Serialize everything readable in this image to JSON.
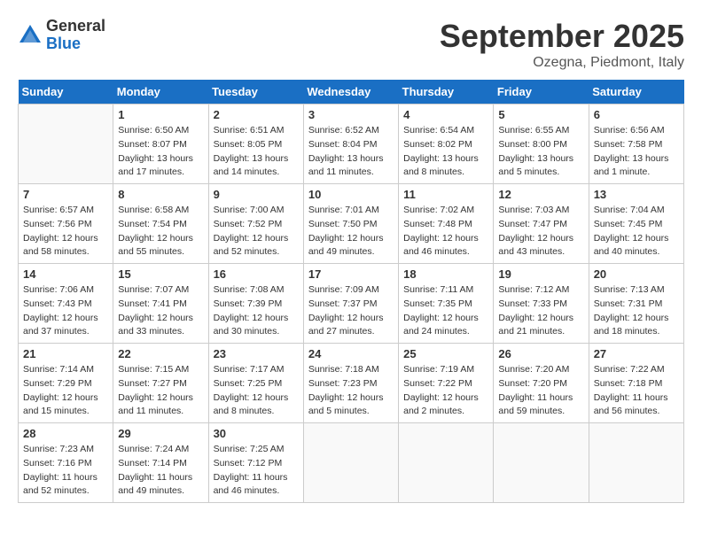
{
  "header": {
    "logo_general": "General",
    "logo_blue": "Blue",
    "month_title": "September 2025",
    "location": "Ozegna, Piedmont, Italy"
  },
  "days_of_week": [
    "Sunday",
    "Monday",
    "Tuesday",
    "Wednesday",
    "Thursday",
    "Friday",
    "Saturday"
  ],
  "weeks": [
    [
      {
        "day": "",
        "sunrise": "",
        "sunset": "",
        "daylight": ""
      },
      {
        "day": "1",
        "sunrise": "Sunrise: 6:50 AM",
        "sunset": "Sunset: 8:07 PM",
        "daylight": "Daylight: 13 hours and 17 minutes."
      },
      {
        "day": "2",
        "sunrise": "Sunrise: 6:51 AM",
        "sunset": "Sunset: 8:05 PM",
        "daylight": "Daylight: 13 hours and 14 minutes."
      },
      {
        "day": "3",
        "sunrise": "Sunrise: 6:52 AM",
        "sunset": "Sunset: 8:04 PM",
        "daylight": "Daylight: 13 hours and 11 minutes."
      },
      {
        "day": "4",
        "sunrise": "Sunrise: 6:54 AM",
        "sunset": "Sunset: 8:02 PM",
        "daylight": "Daylight: 13 hours and 8 minutes."
      },
      {
        "day": "5",
        "sunrise": "Sunrise: 6:55 AM",
        "sunset": "Sunset: 8:00 PM",
        "daylight": "Daylight: 13 hours and 5 minutes."
      },
      {
        "day": "6",
        "sunrise": "Sunrise: 6:56 AM",
        "sunset": "Sunset: 7:58 PM",
        "daylight": "Daylight: 13 hours and 1 minute."
      }
    ],
    [
      {
        "day": "7",
        "sunrise": "Sunrise: 6:57 AM",
        "sunset": "Sunset: 7:56 PM",
        "daylight": "Daylight: 12 hours and 58 minutes."
      },
      {
        "day": "8",
        "sunrise": "Sunrise: 6:58 AM",
        "sunset": "Sunset: 7:54 PM",
        "daylight": "Daylight: 12 hours and 55 minutes."
      },
      {
        "day": "9",
        "sunrise": "Sunrise: 7:00 AM",
        "sunset": "Sunset: 7:52 PM",
        "daylight": "Daylight: 12 hours and 52 minutes."
      },
      {
        "day": "10",
        "sunrise": "Sunrise: 7:01 AM",
        "sunset": "Sunset: 7:50 PM",
        "daylight": "Daylight: 12 hours and 49 minutes."
      },
      {
        "day": "11",
        "sunrise": "Sunrise: 7:02 AM",
        "sunset": "Sunset: 7:48 PM",
        "daylight": "Daylight: 12 hours and 46 minutes."
      },
      {
        "day": "12",
        "sunrise": "Sunrise: 7:03 AM",
        "sunset": "Sunset: 7:47 PM",
        "daylight": "Daylight: 12 hours and 43 minutes."
      },
      {
        "day": "13",
        "sunrise": "Sunrise: 7:04 AM",
        "sunset": "Sunset: 7:45 PM",
        "daylight": "Daylight: 12 hours and 40 minutes."
      }
    ],
    [
      {
        "day": "14",
        "sunrise": "Sunrise: 7:06 AM",
        "sunset": "Sunset: 7:43 PM",
        "daylight": "Daylight: 12 hours and 37 minutes."
      },
      {
        "day": "15",
        "sunrise": "Sunrise: 7:07 AM",
        "sunset": "Sunset: 7:41 PM",
        "daylight": "Daylight: 12 hours and 33 minutes."
      },
      {
        "day": "16",
        "sunrise": "Sunrise: 7:08 AM",
        "sunset": "Sunset: 7:39 PM",
        "daylight": "Daylight: 12 hours and 30 minutes."
      },
      {
        "day": "17",
        "sunrise": "Sunrise: 7:09 AM",
        "sunset": "Sunset: 7:37 PM",
        "daylight": "Daylight: 12 hours and 27 minutes."
      },
      {
        "day": "18",
        "sunrise": "Sunrise: 7:11 AM",
        "sunset": "Sunset: 7:35 PM",
        "daylight": "Daylight: 12 hours and 24 minutes."
      },
      {
        "day": "19",
        "sunrise": "Sunrise: 7:12 AM",
        "sunset": "Sunset: 7:33 PM",
        "daylight": "Daylight: 12 hours and 21 minutes."
      },
      {
        "day": "20",
        "sunrise": "Sunrise: 7:13 AM",
        "sunset": "Sunset: 7:31 PM",
        "daylight": "Daylight: 12 hours and 18 minutes."
      }
    ],
    [
      {
        "day": "21",
        "sunrise": "Sunrise: 7:14 AM",
        "sunset": "Sunset: 7:29 PM",
        "daylight": "Daylight: 12 hours and 15 minutes."
      },
      {
        "day": "22",
        "sunrise": "Sunrise: 7:15 AM",
        "sunset": "Sunset: 7:27 PM",
        "daylight": "Daylight: 12 hours and 11 minutes."
      },
      {
        "day": "23",
        "sunrise": "Sunrise: 7:17 AM",
        "sunset": "Sunset: 7:25 PM",
        "daylight": "Daylight: 12 hours and 8 minutes."
      },
      {
        "day": "24",
        "sunrise": "Sunrise: 7:18 AM",
        "sunset": "Sunset: 7:23 PM",
        "daylight": "Daylight: 12 hours and 5 minutes."
      },
      {
        "day": "25",
        "sunrise": "Sunrise: 7:19 AM",
        "sunset": "Sunset: 7:22 PM",
        "daylight": "Daylight: 12 hours and 2 minutes."
      },
      {
        "day": "26",
        "sunrise": "Sunrise: 7:20 AM",
        "sunset": "Sunset: 7:20 PM",
        "daylight": "Daylight: 11 hours and 59 minutes."
      },
      {
        "day": "27",
        "sunrise": "Sunrise: 7:22 AM",
        "sunset": "Sunset: 7:18 PM",
        "daylight": "Daylight: 11 hours and 56 minutes."
      }
    ],
    [
      {
        "day": "28",
        "sunrise": "Sunrise: 7:23 AM",
        "sunset": "Sunset: 7:16 PM",
        "daylight": "Daylight: 11 hours and 52 minutes."
      },
      {
        "day": "29",
        "sunrise": "Sunrise: 7:24 AM",
        "sunset": "Sunset: 7:14 PM",
        "daylight": "Daylight: 11 hours and 49 minutes."
      },
      {
        "day": "30",
        "sunrise": "Sunrise: 7:25 AM",
        "sunset": "Sunset: 7:12 PM",
        "daylight": "Daylight: 11 hours and 46 minutes."
      },
      {
        "day": "",
        "sunrise": "",
        "sunset": "",
        "daylight": ""
      },
      {
        "day": "",
        "sunrise": "",
        "sunset": "",
        "daylight": ""
      },
      {
        "day": "",
        "sunrise": "",
        "sunset": "",
        "daylight": ""
      },
      {
        "day": "",
        "sunrise": "",
        "sunset": "",
        "daylight": ""
      }
    ]
  ]
}
